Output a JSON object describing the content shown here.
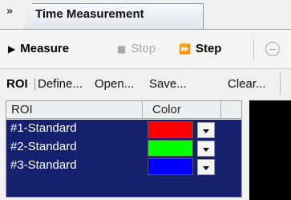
{
  "tab": {
    "title": "Time Measurement"
  },
  "toolbar": {
    "measure_label": "Measure",
    "stop_label": "Stop",
    "step_label": "Step"
  },
  "roi_bar": {
    "label": "ROI",
    "links": [
      "Define...",
      "Open...",
      "Save...",
      "Clear..."
    ]
  },
  "table": {
    "columns": [
      "ROI",
      "Color"
    ],
    "rows": [
      {
        "label": "#1-Standard",
        "color": "#ff0000"
      },
      {
        "label": "#2-Standard",
        "color": "#00ff00"
      },
      {
        "label": "#3-Standard",
        "color": "#0000ff"
      }
    ]
  },
  "colors": {
    "selection_bg": "#15216f",
    "panel_bg": "#000000"
  },
  "icons": {
    "collapse": "double-chevron-down-icon",
    "measure": "play-icon",
    "stop": "stop-icon",
    "step": "step-forward-icon",
    "remove": "minus-circle-icon"
  }
}
